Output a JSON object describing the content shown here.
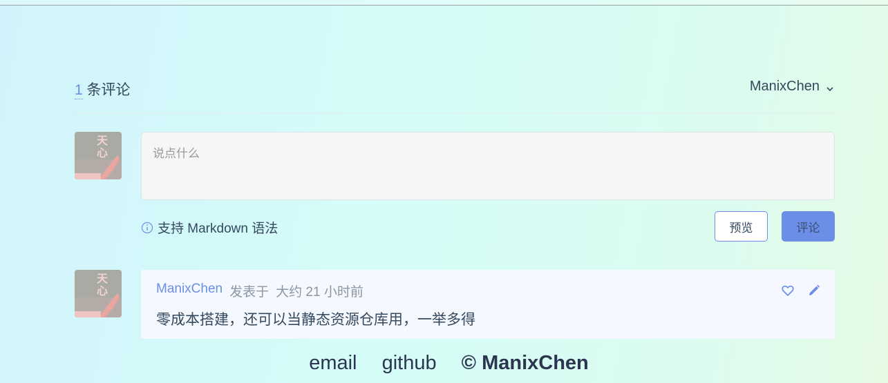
{
  "comments_header": {
    "count": "1",
    "count_suffix": " 条评论",
    "user_name": "ManixChen"
  },
  "avatar": {
    "text_line1": "天",
    "text_line2": "心"
  },
  "editor": {
    "placeholder": "说点什么"
  },
  "hint": {
    "text": "支持 Markdown 语法"
  },
  "buttons": {
    "preview": "预览",
    "submit": "评论"
  },
  "comment": {
    "author": "ManixChen",
    "posted_label": "发表于",
    "time": "大约 21 小时前",
    "body": "零成本搭建，还可以当静态资源仓库用，一举多得"
  },
  "footer": {
    "email": "email",
    "github": "github",
    "copyright": "© ManixChen"
  },
  "colors": {
    "accent": "#6b8fe6",
    "text": "#34495e"
  },
  "icons": [
    "chevron-down-icon",
    "info-icon",
    "heart-icon",
    "edit-icon"
  ]
}
